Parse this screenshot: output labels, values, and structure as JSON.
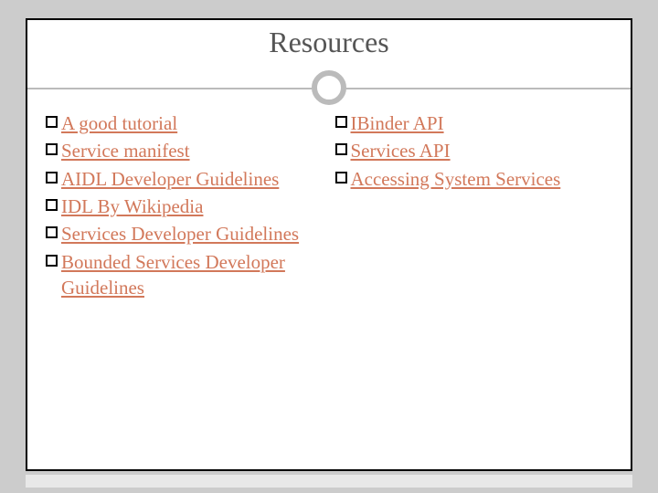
{
  "title": "Resources",
  "columns": {
    "left": [
      {
        "label": "A good tutorial"
      },
      {
        "label": "Service manifest"
      },
      {
        "label": "AIDL Developer Guidelines"
      },
      {
        "label": "IDL By Wikipedia"
      },
      {
        "label": "Services Developer Guidelines"
      },
      {
        "label": "Bounded Services Developer Guidelines"
      }
    ],
    "right": [
      {
        "label": "IBinder API"
      },
      {
        "label": "Services API"
      },
      {
        "label": "Accessing System Services"
      }
    ]
  },
  "colors": {
    "link": "#d2785a",
    "background": "#cccccc"
  }
}
